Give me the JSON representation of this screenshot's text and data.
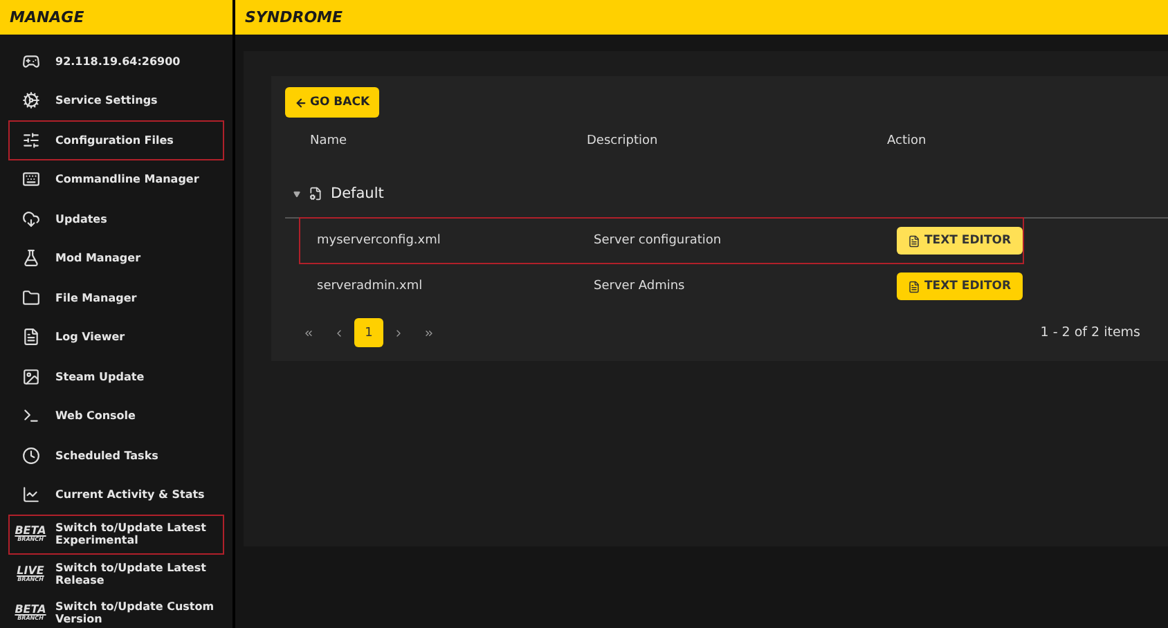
{
  "sidebar": {
    "title": "MANAGE",
    "items": [
      {
        "label": "92.118.19.64:26900",
        "kind": "icon",
        "highlighted": false
      },
      {
        "label": "Service Settings",
        "kind": "icon",
        "highlighted": false
      },
      {
        "label": "Configuration Files",
        "kind": "icon",
        "highlighted": true
      },
      {
        "label": "Commandline Manager",
        "kind": "icon",
        "highlighted": false
      },
      {
        "label": "Updates",
        "kind": "icon",
        "highlighted": false
      },
      {
        "label": "Mod Manager",
        "kind": "icon",
        "highlighted": false
      },
      {
        "label": "File Manager",
        "kind": "icon",
        "highlighted": false
      },
      {
        "label": "Log Viewer",
        "kind": "icon",
        "highlighted": false
      },
      {
        "label": "Steam Update",
        "kind": "icon",
        "highlighted": false
      },
      {
        "label": "Web Console",
        "kind": "icon",
        "highlighted": false
      },
      {
        "label": "Scheduled Tasks",
        "kind": "icon",
        "highlighted": false
      },
      {
        "label": "Current Activity & Stats",
        "kind": "icon",
        "highlighted": false
      },
      {
        "label": "Switch to/Update Latest Experimental",
        "kind": "badge",
        "badge": "BETA",
        "badge_sub": "BRANCH",
        "highlighted": true
      },
      {
        "label": "Switch to/Update Latest Release",
        "kind": "badge",
        "badge": "LIVE",
        "badge_sub": "BRANCH",
        "highlighted": false
      },
      {
        "label": "Switch to/Update Custom Version",
        "kind": "badge",
        "badge": "BETA",
        "badge_sub": "BRANCH",
        "highlighted": false
      }
    ]
  },
  "header": {
    "title": "SYNDROME"
  },
  "go_back": "GO BACK",
  "table": {
    "columns": [
      "Name",
      "Description",
      "Action"
    ],
    "group": {
      "label": "Default",
      "expanded": true
    },
    "rows": [
      {
        "name": "myserverconfig.xml",
        "description": "Server configuration",
        "action": "TEXT EDITOR",
        "highlighted": true,
        "hovered": true
      },
      {
        "name": "serveradmin.xml",
        "description": "Server Admins",
        "action": "TEXT EDITOR",
        "highlighted": false,
        "hovered": false
      }
    ]
  },
  "pager": {
    "pages": [
      {
        "label": "1",
        "selected": true
      }
    ],
    "summary": "1 - 2 of 2 items"
  }
}
